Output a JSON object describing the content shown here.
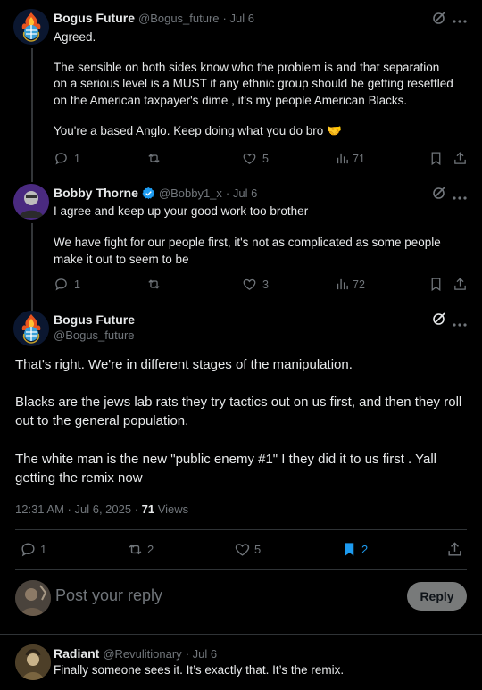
{
  "post1": {
    "name": "Bogus Future",
    "handle": "@Bogus_future",
    "date": "· Jul 6",
    "lines": [
      "Agreed.",
      "The sensible on both sides know who the problem is and that separation",
      "on a serious level is a MUST if any ethnic group should be getting resettled",
      "on the American taxpayer's dime , it's my people American Blacks.",
      "You're a based Anglo. Keep doing what you do bro 🤝"
    ],
    "replies": "1",
    "likes": "5",
    "views": "71"
  },
  "post2": {
    "name": "Bobby Thorne",
    "handle": "@Bobby1_x",
    "date": "· Jul 6",
    "lines": [
      "I agree and keep up your good work too brother",
      "We have fight for our people first, it's not as complicated as some people",
      "make it out to seem to be"
    ],
    "replies": "1",
    "likes": "3",
    "views": "72"
  },
  "main": {
    "name": "Bogus Future",
    "handle": "@Bogus_future",
    "paragraphs": [
      "That's right. We're in different stages of the manipulation.",
      "Blacks are the jews lab rats they try tactics out on us first, and then they roll out to the general population.",
      "The white man is the new \"public enemy #1\" I they did it to us first . Yall getting the remix now"
    ],
    "timestamp": "12:31 AM · Jul 6, 2025 · ",
    "views_count": "71",
    "views_label": " Views",
    "replies": "1",
    "reposts": "2",
    "likes": "5",
    "bookmarks": "2"
  },
  "composer": {
    "placeholder": "Post your reply",
    "button": "Reply"
  },
  "post3": {
    "name": "Radiant",
    "handle": "@Revulitionary",
    "date": "· Jul 6",
    "text": "Finally someone sees it. It’s exactly that. It’s the remix."
  },
  "colors": {
    "background": "#000000",
    "text": "#e7e9ea",
    "muted": "#71767b",
    "accent": "#1d9bf0",
    "divider": "#2f3336"
  }
}
